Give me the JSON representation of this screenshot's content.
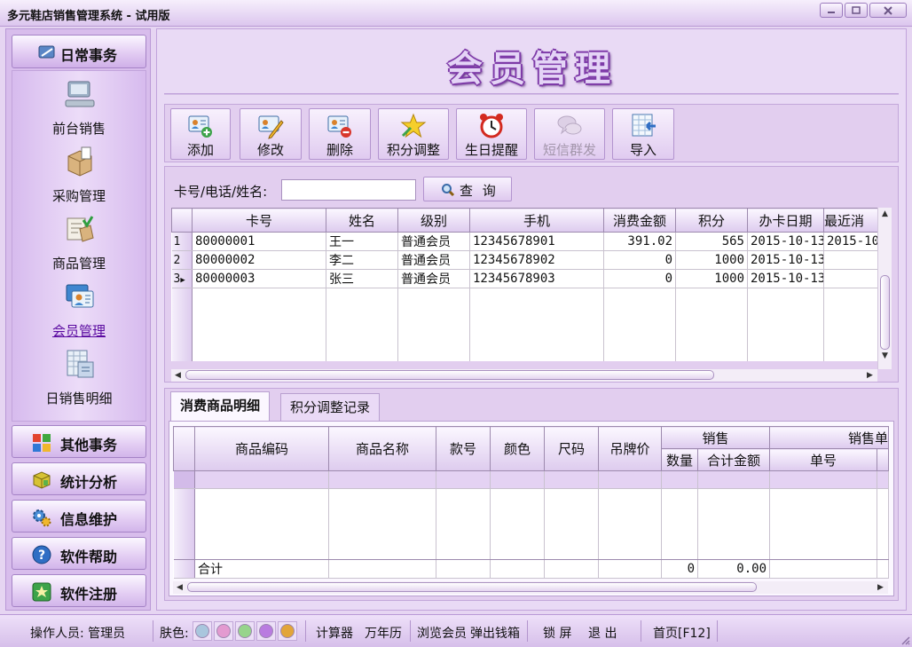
{
  "window": {
    "title": "多元鞋店销售管理系统 - 试用版"
  },
  "sidebar": {
    "header": "日常事务",
    "items": [
      {
        "label": "前台销售",
        "icon": "computer-icon"
      },
      {
        "label": "采购管理",
        "icon": "package-icon"
      },
      {
        "label": "商品管理",
        "icon": "products-icon"
      },
      {
        "label": "会员管理",
        "icon": "member-card-icon",
        "active": true
      },
      {
        "label": "日销售明细",
        "icon": "sales-report-icon"
      }
    ],
    "buttons": [
      {
        "label": "其他事务",
        "icon": "windows-icon"
      },
      {
        "label": "统计分析",
        "icon": "cube-icon"
      },
      {
        "label": "信息维护",
        "icon": "gears-icon"
      },
      {
        "label": "软件帮助",
        "icon": "help-icon"
      },
      {
        "label": "软件注册",
        "icon": "register-icon"
      }
    ]
  },
  "page": {
    "heading": "会员管理"
  },
  "toolbar": {
    "buttons": [
      {
        "label": "添加",
        "icon": "add-member-icon",
        "enabled": true
      },
      {
        "label": "修改",
        "icon": "edit-member-icon",
        "enabled": true
      },
      {
        "label": "删除",
        "icon": "delete-member-icon",
        "enabled": true
      },
      {
        "label": "积分调整",
        "icon": "star-icon",
        "enabled": true
      },
      {
        "label": "生日提醒",
        "icon": "alarm-clock-icon",
        "enabled": true
      },
      {
        "label": "短信群发",
        "icon": "sms-icon",
        "enabled": false
      },
      {
        "label": "导入",
        "icon": "import-icon",
        "enabled": true
      }
    ]
  },
  "search": {
    "label": "卡号/电话/姓名:",
    "value": "",
    "button": "查 询"
  },
  "members_table": {
    "columns": [
      "卡号",
      "姓名",
      "级别",
      "手机",
      "消费金额",
      "积分",
      "办卡日期",
      "最近消"
    ],
    "rows": [
      {
        "no": "1",
        "card": "80000001",
        "name": "王一",
        "level": "普通会员",
        "phone": "12345678901",
        "amount": "391.02",
        "points": "565",
        "date": "2015-10-13",
        "last": "2015-10"
      },
      {
        "no": "2",
        "card": "80000002",
        "name": "李二",
        "level": "普通会员",
        "phone": "12345678902",
        "amount": "0",
        "points": "1000",
        "date": "2015-10-13",
        "last": ""
      },
      {
        "no": "3",
        "card": "80000003",
        "name": "张三",
        "level": "普通会员",
        "phone": "12345678903",
        "amount": "0",
        "points": "1000",
        "date": "2015-10-13",
        "last": ""
      }
    ]
  },
  "detail": {
    "tabs": [
      "消费商品明细",
      "积分调整记录"
    ],
    "columns": [
      "商品编码",
      "商品名称",
      "款号",
      "颜色",
      "尺码",
      "吊牌价"
    ],
    "group_sales": "销售",
    "group_sales_sub": [
      "数量",
      "合计金额"
    ],
    "group_order": "销售单",
    "group_order_sub": [
      "单号"
    ],
    "total_label": "合计",
    "total_qty": "0",
    "total_amount": "0.00"
  },
  "statusbar": {
    "operator": "操作人员: 管理员",
    "skin_label": "肤色:",
    "skins": [
      "#a9c6dd",
      "#e39ad0",
      "#97d48c",
      "#b97be0",
      "#e2a53a"
    ],
    "calculator": "计算器",
    "calendar": "万年历",
    "browse_member": "浏览会员",
    "cash_drawer": "弹出钱箱",
    "lock": "锁 屏",
    "exit": "退 出",
    "home": "首页[F12]"
  }
}
